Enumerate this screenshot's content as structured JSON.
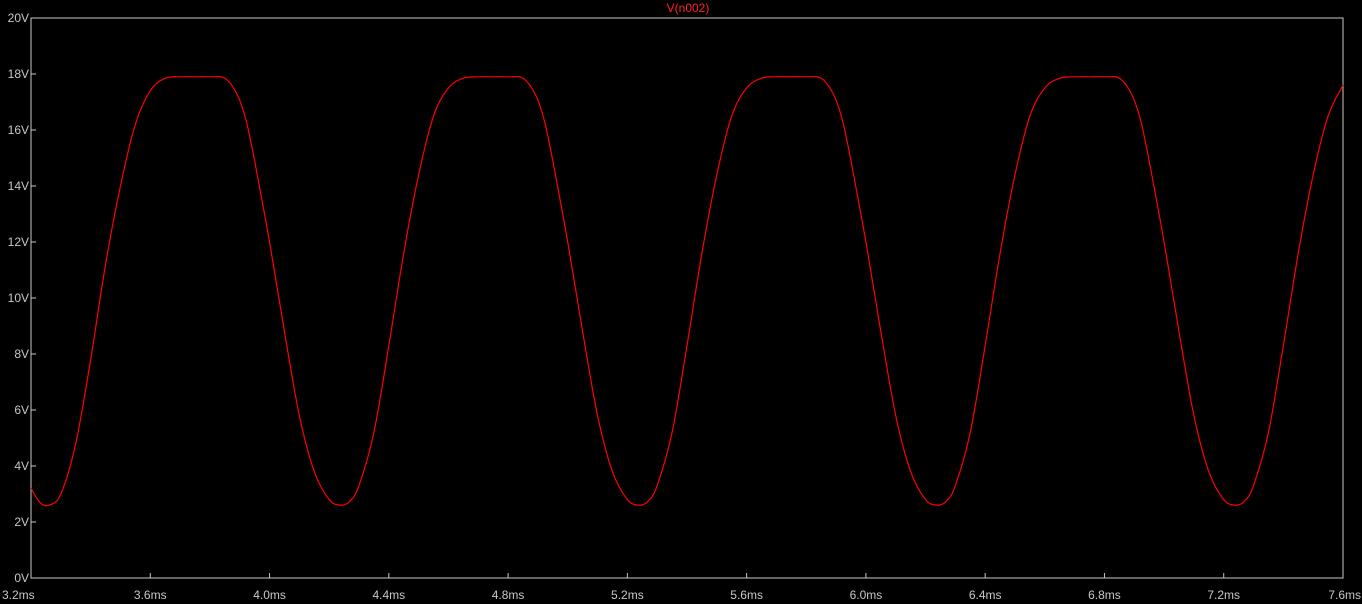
{
  "window": {
    "background": "#000000"
  },
  "chart_data": {
    "type": "line",
    "title": "V(n002)",
    "xlabel": "",
    "ylabel": "",
    "xlim": [
      3.2,
      7.6
    ],
    "ylim": [
      0,
      20
    ],
    "x_unit": "ms",
    "y_unit": "V",
    "x_ticks": [
      "3.2ms",
      "3.6ms",
      "4.0ms",
      "4.4ms",
      "4.8ms",
      "5.2ms",
      "5.6ms",
      "6.0ms",
      "6.4ms",
      "6.8ms",
      "7.2ms",
      "7.6ms"
    ],
    "y_ticks": [
      "0V",
      "2V",
      "4V",
      "6V",
      "8V",
      "10V",
      "12V",
      "14V",
      "16V",
      "18V",
      "20V"
    ],
    "grid": false,
    "trace_color": "#ff0000",
    "axis_color": "#c8c8c8",
    "series": [
      {
        "name": "V(n002)",
        "x": [
          3.2,
          3.23,
          3.26,
          3.3,
          3.35,
          3.4,
          3.45,
          3.5,
          3.55,
          3.6,
          3.65,
          3.7,
          3.75,
          3.8,
          3.85,
          3.89,
          3.92,
          3.95,
          4.0,
          4.05,
          4.1,
          4.15,
          4.2,
          4.24,
          4.27,
          4.3,
          4.35,
          4.4,
          4.45,
          4.5,
          4.55,
          4.6,
          4.65,
          4.7,
          4.75,
          4.8,
          4.85,
          4.89,
          4.92,
          4.95,
          5.0,
          5.05,
          5.1,
          5.15,
          5.2,
          5.24,
          5.27,
          5.3,
          5.35,
          5.4,
          5.45,
          5.5,
          5.55,
          5.6,
          5.65,
          5.7,
          5.75,
          5.8,
          5.85,
          5.89,
          5.92,
          5.95,
          6.0,
          6.05,
          6.1,
          6.15,
          6.2,
          6.24,
          6.27,
          6.3,
          6.35,
          6.4,
          6.45,
          6.5,
          6.55,
          6.6,
          6.65,
          6.7,
          6.75,
          6.8,
          6.85,
          6.89,
          6.92,
          6.95,
          7.0,
          7.05,
          7.1,
          7.15,
          7.2,
          7.24,
          7.27,
          7.3,
          7.35,
          7.4,
          7.45,
          7.5,
          7.55,
          7.6
        ],
        "y": [
          3.2,
          2.7,
          2.6,
          3.0,
          4.8,
          7.8,
          11.2,
          14.0,
          16.2,
          17.4,
          17.85,
          17.9,
          17.9,
          17.9,
          17.85,
          17.3,
          16.4,
          14.9,
          12.0,
          8.8,
          5.8,
          3.8,
          2.8,
          2.6,
          2.75,
          3.3,
          5.2,
          8.3,
          11.6,
          14.4,
          16.5,
          17.5,
          17.85,
          17.9,
          17.9,
          17.9,
          17.85,
          17.3,
          16.4,
          14.9,
          12.0,
          8.8,
          5.8,
          3.8,
          2.8,
          2.6,
          2.75,
          3.3,
          5.2,
          8.3,
          11.6,
          14.4,
          16.5,
          17.5,
          17.85,
          17.9,
          17.9,
          17.9,
          17.85,
          17.3,
          16.4,
          14.9,
          12.0,
          8.8,
          5.8,
          3.8,
          2.8,
          2.6,
          2.75,
          3.3,
          5.2,
          8.3,
          11.6,
          14.4,
          16.5,
          17.5,
          17.85,
          17.9,
          17.9,
          17.9,
          17.85,
          17.3,
          16.4,
          14.9,
          12.0,
          8.8,
          5.8,
          3.8,
          2.8,
          2.6,
          2.75,
          3.3,
          5.2,
          8.3,
          11.6,
          14.4,
          16.5,
          17.6
        ]
      }
    ]
  }
}
